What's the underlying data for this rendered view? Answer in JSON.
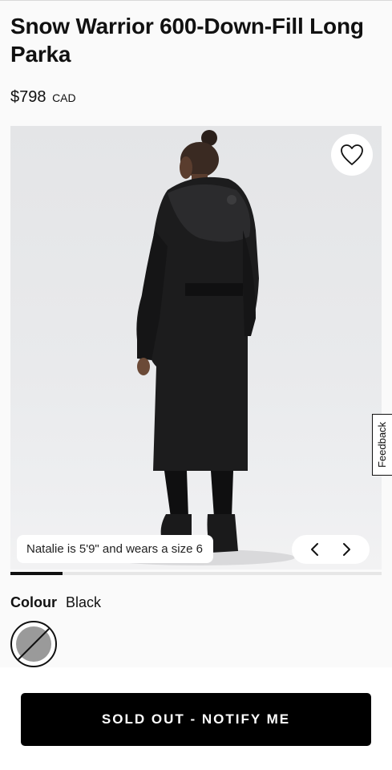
{
  "product": {
    "title": "Snow Warrior 600-Down-Fill Long Parka",
    "price": "$798",
    "currency": "CAD"
  },
  "gallery": {
    "model_caption": "Natalie is 5'9\" and wears a size 6",
    "image_index": 1,
    "image_count": 6,
    "progress_fraction": 0.14
  },
  "feedback": {
    "label": "Feedback"
  },
  "colour": {
    "label": "Colour",
    "selected": "Black",
    "swatches": [
      {
        "name": "Black",
        "available": false
      }
    ]
  },
  "cta": {
    "label": "SOLD OUT - NOTIFY ME"
  },
  "icons": {
    "wishlist": "heart-icon",
    "prev": "chevron-left-icon",
    "next": "chevron-right-icon"
  },
  "colors": {
    "accent": "#000000",
    "background": "#fafafa",
    "image_bg": "#e8e9eb"
  }
}
